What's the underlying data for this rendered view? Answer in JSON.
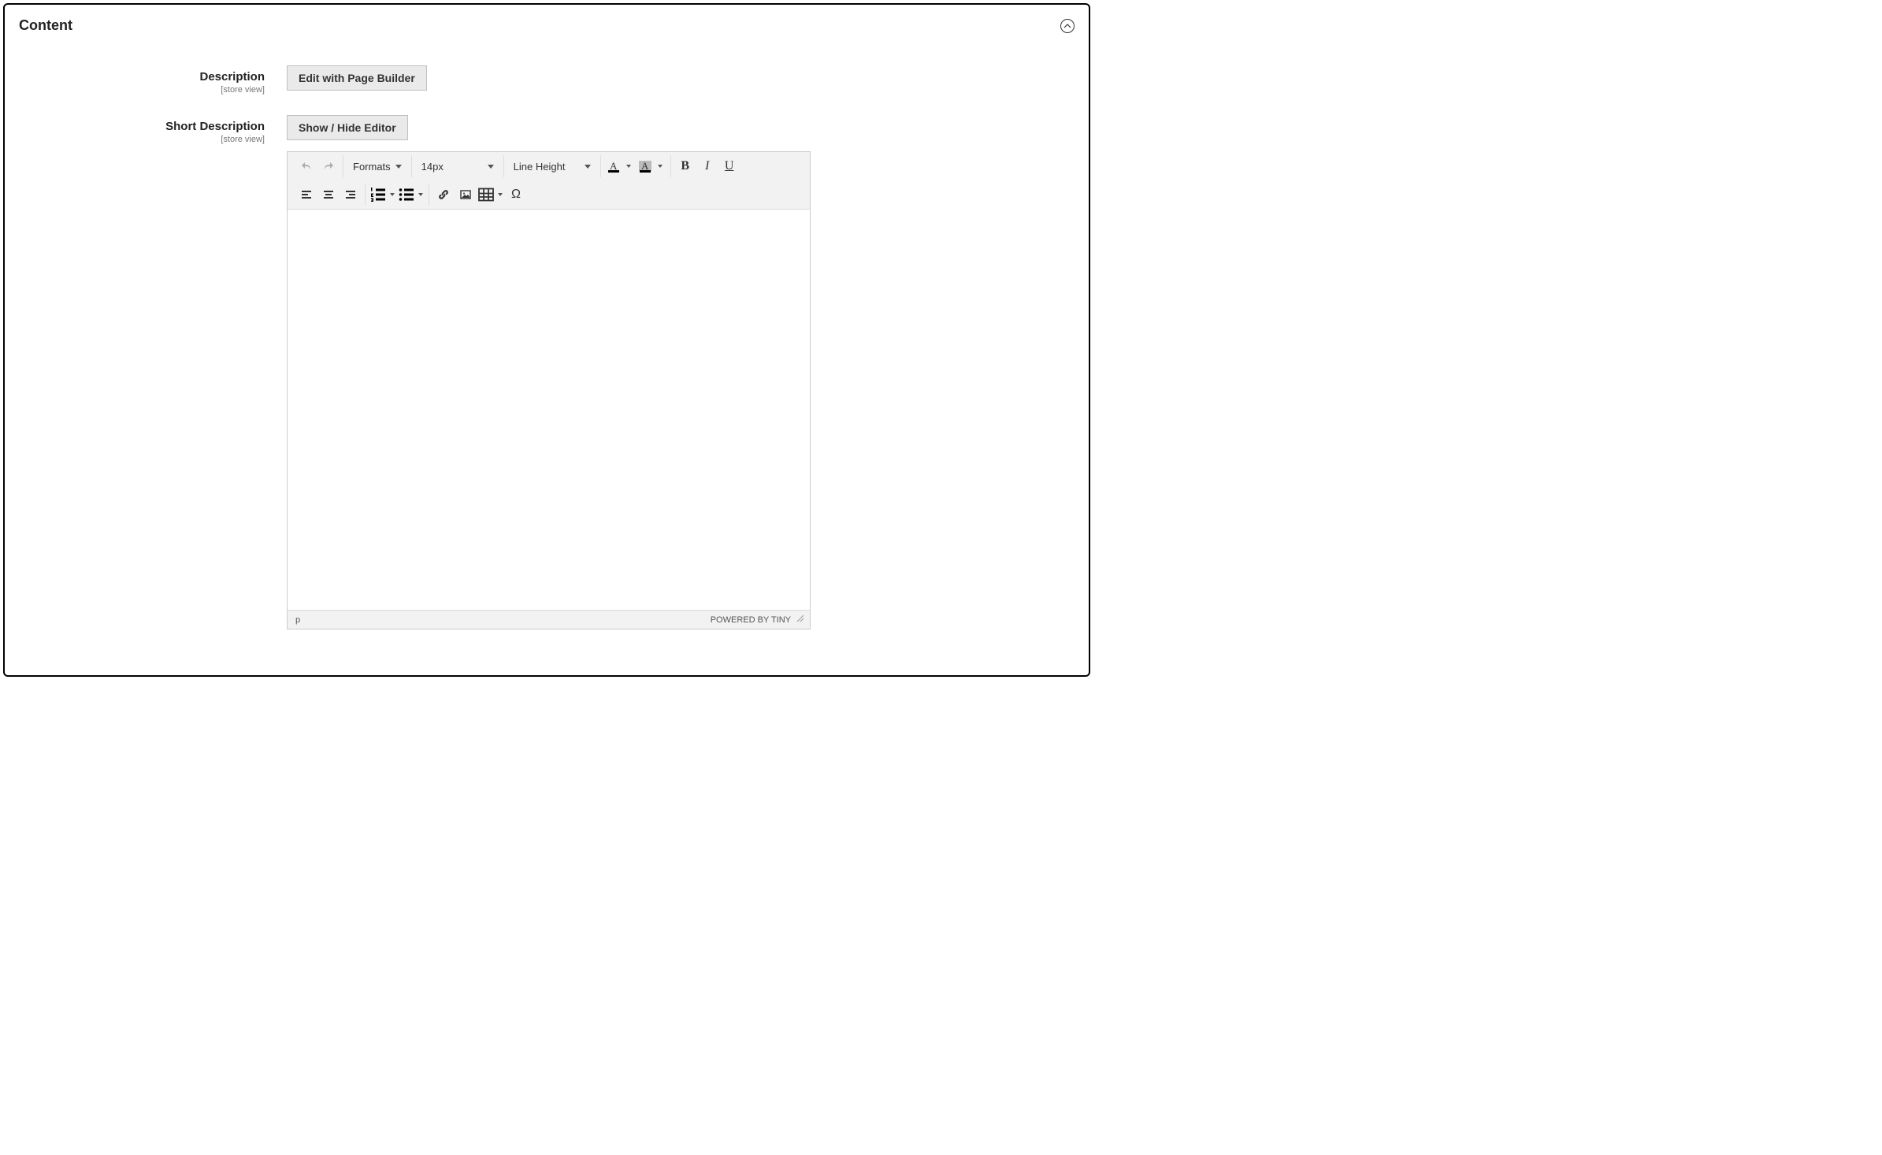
{
  "panel": {
    "title": "Content"
  },
  "fields": {
    "description": {
      "label": "Description",
      "scope": "[store view]",
      "button": "Edit with Page Builder"
    },
    "short_description": {
      "label": "Short Description",
      "scope": "[store view]",
      "button": "Show / Hide Editor"
    }
  },
  "editor": {
    "formats_label": "Formats",
    "font_size": "14px",
    "line_height_label": "Line Height",
    "bold_glyph": "B",
    "italic_glyph": "I",
    "underline_glyph": "U",
    "text_color_letter": "A",
    "bg_color_letter": "A",
    "omega_glyph": "Ω",
    "status_path": "p",
    "powered_by": "POWERED BY TINY"
  }
}
